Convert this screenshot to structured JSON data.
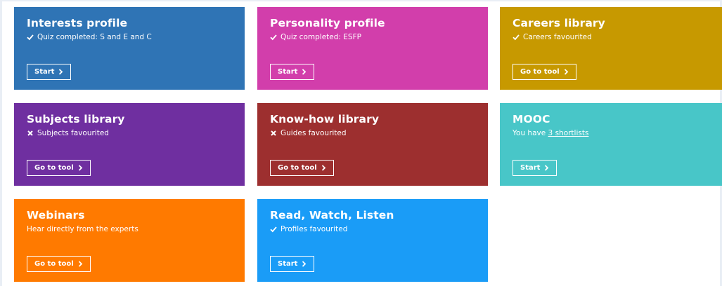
{
  "colors": {
    "interests": "#2f74b5",
    "personality": "#d23eab",
    "careers": "#c79900",
    "subjects": "#6f2fa0",
    "knowhow": "#9d2f2f",
    "mooc": "#48c6c8",
    "webinars": "#ff7a00",
    "rwl": "#1a9cf7"
  },
  "tiles": {
    "interests": {
      "title": "Interests profile",
      "status": "Quiz completed: S and E and C",
      "status_icon": "check-icon",
      "button": "Start"
    },
    "personality": {
      "title": "Personality profile",
      "status": "Quiz completed: ESFP",
      "status_icon": "check-icon",
      "button": "Start"
    },
    "careers": {
      "title": "Careers library",
      "status": "Careers favourited",
      "status_icon": "check-icon",
      "button": "Go to tool"
    },
    "subjects": {
      "title": "Subjects library",
      "status": "Subjects favourited",
      "status_icon": "cross-icon",
      "button": "Go to tool"
    },
    "knowhow": {
      "title": "Know-how library",
      "status": "Guides favourited",
      "status_icon": "cross-icon",
      "button": "Go to tool"
    },
    "mooc": {
      "title": "MOOC",
      "status_prefix": "You have ",
      "status_link": "3 shortlists",
      "button": "Start"
    },
    "webinars": {
      "title": "Webinars",
      "status": "Hear directly from the experts",
      "button": "Go to tool"
    },
    "rwl": {
      "title": "Read, Watch, Listen",
      "status": "Profiles favourited",
      "status_icon": "check-icon",
      "button": "Start"
    }
  }
}
